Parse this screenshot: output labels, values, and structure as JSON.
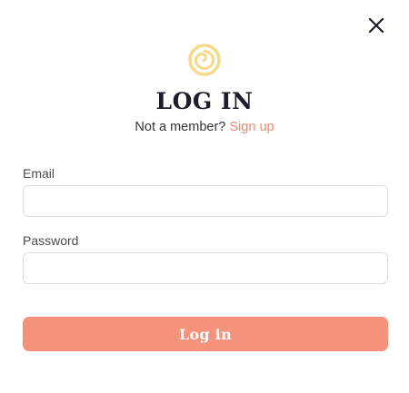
{
  "dialog": {
    "close_icon": "close-icon",
    "logo_icon": "spiral-logo-icon",
    "title": "LOG IN",
    "subtitle_text": "Not a member?",
    "signup_link": "Sign up"
  },
  "form": {
    "email_label": "Email",
    "email_value": "",
    "email_placeholder": "",
    "password_label": "Password",
    "password_value": "",
    "password_placeholder": "",
    "submit_label": "Log in"
  },
  "colors": {
    "accent": "#f4927b",
    "link": "#f2876d",
    "logo": "#f7d98a",
    "title": "#1e1e2a",
    "input_border": "#dedede"
  }
}
